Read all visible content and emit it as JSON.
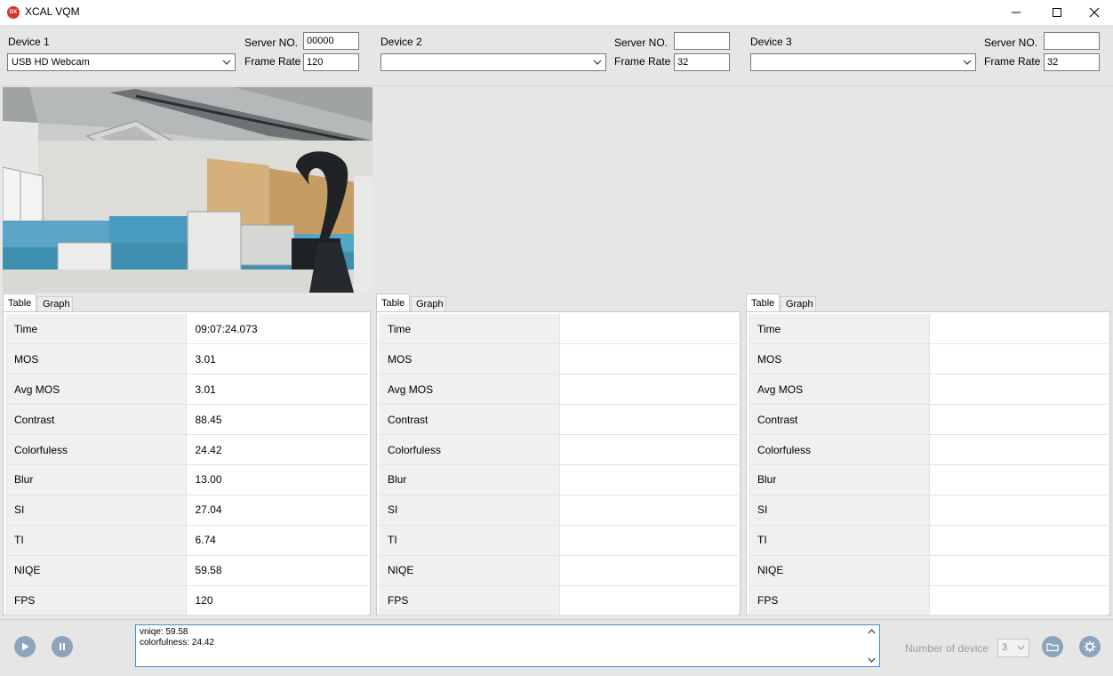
{
  "window": {
    "title": "XCAL VQM",
    "icon_text": "DX"
  },
  "devices": [
    {
      "label": "Device 1",
      "server_label": "Server NO.",
      "server_value": "00000",
      "frame_rate_label": "Frame Rate",
      "frame_rate_value": "120",
      "camera": "USB HD Webcam",
      "tabs": [
        "Table",
        "Graph"
      ],
      "rows": [
        {
          "key": "Time",
          "value": "09:07:24.073"
        },
        {
          "key": "MOS",
          "value": "3.01"
        },
        {
          "key": "Avg MOS",
          "value": "3.01"
        },
        {
          "key": "Contrast",
          "value": "88.45"
        },
        {
          "key": "Colorfuless",
          "value": "24.42"
        },
        {
          "key": "Blur",
          "value": "13.00"
        },
        {
          "key": "SI",
          "value": "27.04"
        },
        {
          "key": "TI",
          "value": "6.74"
        },
        {
          "key": "NIQE",
          "value": "59.58"
        },
        {
          "key": "FPS",
          "value": "120"
        }
      ]
    },
    {
      "label": "Device 2",
      "server_label": "Server NO.",
      "server_value": "",
      "frame_rate_label": "Frame Rate",
      "frame_rate_value": "32",
      "camera": "",
      "tabs": [
        "Table",
        "Graph"
      ],
      "rows": [
        {
          "key": "Time",
          "value": ""
        },
        {
          "key": "MOS",
          "value": ""
        },
        {
          "key": "Avg MOS",
          "value": ""
        },
        {
          "key": "Contrast",
          "value": ""
        },
        {
          "key": "Colorfuless",
          "value": ""
        },
        {
          "key": "Blur",
          "value": ""
        },
        {
          "key": "SI",
          "value": ""
        },
        {
          "key": "TI",
          "value": ""
        },
        {
          "key": "NIQE",
          "value": ""
        },
        {
          "key": "FPS",
          "value": ""
        }
      ]
    },
    {
      "label": "Device 3",
      "server_label": "Server NO.",
      "server_value": "",
      "frame_rate_label": "Frame Rate",
      "frame_rate_value": "32",
      "camera": "",
      "tabs": [
        "Table",
        "Graph"
      ],
      "rows": [
        {
          "key": "Time",
          "value": ""
        },
        {
          "key": "MOS",
          "value": ""
        },
        {
          "key": "Avg MOS",
          "value": ""
        },
        {
          "key": "Contrast",
          "value": ""
        },
        {
          "key": "Colorfuless",
          "value": ""
        },
        {
          "key": "Blur",
          "value": ""
        },
        {
          "key": "SI",
          "value": ""
        },
        {
          "key": "TI",
          "value": ""
        },
        {
          "key": "NIQE",
          "value": ""
        },
        {
          "key": "FPS",
          "value": ""
        }
      ]
    }
  ],
  "bottom": {
    "log_lines": [
      "vniqe: 59.58",
      "colorfulness: 24.42"
    ],
    "number_of_device_label": "Number of device",
    "number_of_device_value": "3"
  },
  "colors": {
    "background": "#e6e6e6",
    "accent_button": "#8ea4bd",
    "log_border": "#3f8ed8",
    "app_icon": "#d9342b"
  },
  "icons": [
    "app-icon",
    "minimize-icon",
    "maximize-icon",
    "close-icon",
    "chevron-down-icon",
    "play-icon",
    "pause-icon",
    "folder-icon",
    "gear-icon"
  ]
}
